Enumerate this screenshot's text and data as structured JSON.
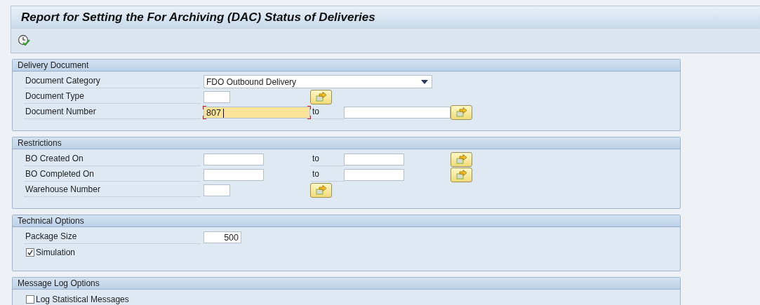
{
  "title": "Report for Setting the For Archiving (DAC) Status of Deliveries",
  "toolbar": [
    {
      "kind": "execute"
    }
  ],
  "groups": [
    {
      "title": "Delivery Document",
      "rows": [
        {
          "kind": "select",
          "label": "Document Category",
          "value": "FDO Outbound Delivery"
        },
        {
          "kind": "single",
          "label": "Document Type",
          "low": {
            "kind": "code",
            "focused": false
          }
        },
        {
          "kind": "range",
          "label": "Document Number",
          "low": {
            "kind": "number",
            "value": "807",
            "focused": true
          },
          "to": "to",
          "high": {
            "kind": "number",
            "focused": false
          }
        }
      ]
    },
    {
      "title": "Restrictions",
      "rows": [
        {
          "kind": "range",
          "label": "BO Created On",
          "low": {
            "kind": "date",
            "focused": false
          },
          "to": "to",
          "high": {
            "kind": "date",
            "focused": false
          }
        },
        {
          "kind": "range",
          "label": "BO Completed On",
          "low": {
            "kind": "date",
            "focused": false
          },
          "to": "to",
          "high": {
            "kind": "date",
            "focused": false
          }
        },
        {
          "kind": "single",
          "label": "Warehouse Number",
          "low": {
            "kind": "code",
            "focused": false
          }
        }
      ]
    },
    {
      "title": "Technical Options",
      "rows": [
        {
          "kind": "value",
          "label": "Package Size",
          "low": {
            "kind": "qty",
            "value": "500",
            "focused": false
          }
        },
        {
          "kind": "checkbox",
          "label": "Simulation",
          "checked": true
        }
      ]
    },
    {
      "title": "Message Log Options",
      "rows": [
        {
          "kind": "checkbox",
          "label": "Log Statistical Messages",
          "checked": false
        }
      ]
    }
  ]
}
